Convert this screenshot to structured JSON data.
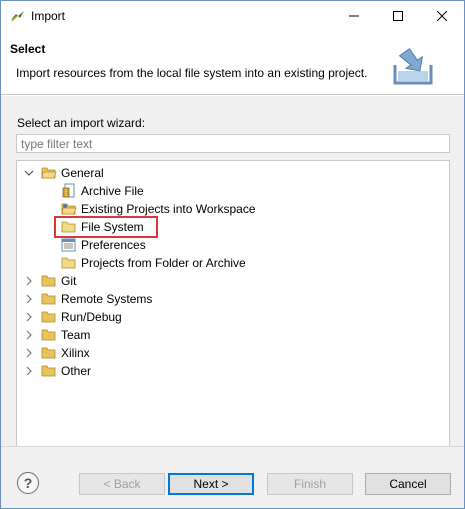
{
  "window": {
    "title": "Import",
    "icon": "eclipse-import-icon"
  },
  "header": {
    "title": "Select",
    "description": "Import resources from the local file system into an existing project."
  },
  "wizard": {
    "label": "Select an import wizard:",
    "filter_placeholder": "type filter text",
    "filter_value": ""
  },
  "tree": {
    "general": {
      "label": "General",
      "expanded": true,
      "children": [
        {
          "label": "Archive File",
          "icon": "archive-file-icon"
        },
        {
          "label": "Existing Projects into Workspace",
          "icon": "projects-folder-icon"
        },
        {
          "label": "File System",
          "icon": "folder-icon",
          "selected": true
        },
        {
          "label": "Preferences",
          "icon": "preferences-icon"
        },
        {
          "label": "Projects from Folder or Archive",
          "icon": "folder-icon"
        }
      ]
    },
    "categories": [
      {
        "label": "Git"
      },
      {
        "label": "Remote Systems"
      },
      {
        "label": "Run/Debug"
      },
      {
        "label": "Team"
      },
      {
        "label": "Xilinx"
      },
      {
        "label": "Other"
      }
    ]
  },
  "footer": {
    "help": "?",
    "back": "< Back",
    "next": "Next >",
    "finish": "Finish",
    "cancel": "Cancel"
  },
  "colors": {
    "accent": "#0078d7",
    "highlight_box": "#d9363e",
    "folder": "#e8c25d"
  }
}
